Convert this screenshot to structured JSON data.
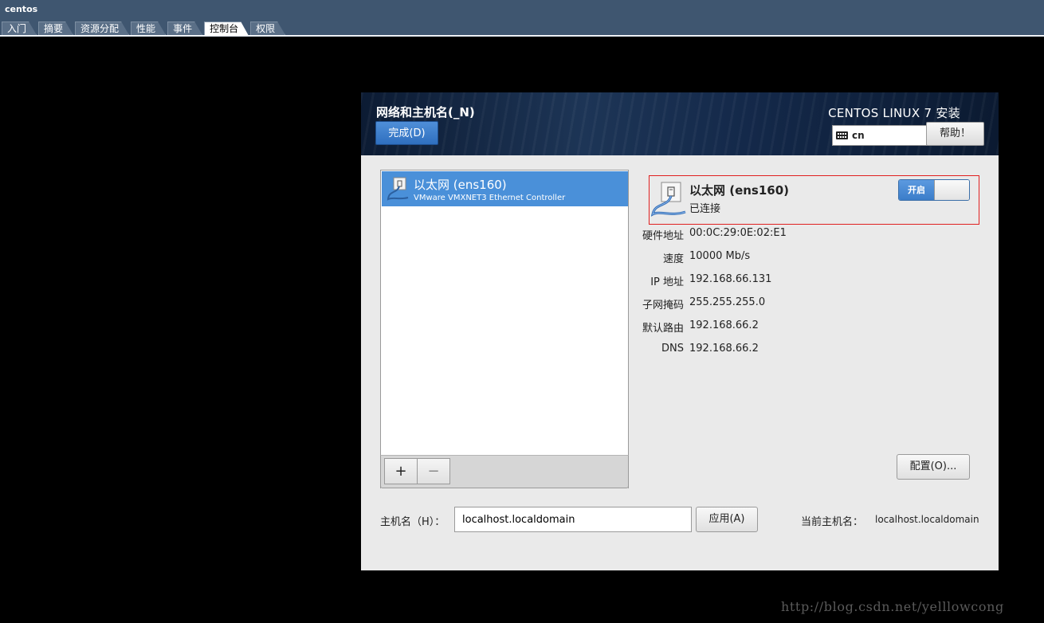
{
  "window": {
    "title": "centos",
    "tabs": [
      {
        "label": "入门",
        "active": false
      },
      {
        "label": "摘要",
        "active": false
      },
      {
        "label": "资源分配",
        "active": false
      },
      {
        "label": "性能",
        "active": false
      },
      {
        "label": "事件",
        "active": false
      },
      {
        "label": "控制台",
        "active": true
      },
      {
        "label": "权限",
        "active": false
      }
    ]
  },
  "header": {
    "spoke_title": "网络和主机名(_N)",
    "done_label": "完成(D)",
    "product_title": "CENTOS LINUX 7 安装",
    "keyboard_layout": "cn",
    "help_label": "帮助！"
  },
  "device_list": {
    "items": [
      {
        "name": "以太网 (ens160)",
        "description": "VMware VMXNET3 Ethernet Controller",
        "selected": true
      }
    ],
    "add_label": "+",
    "remove_label": "−"
  },
  "device_detail": {
    "title": "以太网 (ens160)",
    "status": "已连接",
    "toggle_label": "开启",
    "toggle_on": true,
    "rows": [
      {
        "label": "硬件地址",
        "value": "00:0C:29:0E:02:E1"
      },
      {
        "label": "速度",
        "value": "10000 Mb/s"
      },
      {
        "label": "IP 地址",
        "value": "192.168.66.131"
      },
      {
        "label": "子网掩码",
        "value": "255.255.255.0"
      },
      {
        "label": "默认路由",
        "value": "192.168.66.2"
      },
      {
        "label": "DNS",
        "value": "192.168.66.2"
      }
    ],
    "configure_label": "配置(O)..."
  },
  "hostname": {
    "label": "主机名（H）：",
    "value": "localhost.localdomain",
    "apply_label": "应用(A)",
    "current_label": "当前主机名：",
    "current_value": "localhost.localdomain"
  },
  "watermark": "http://blog.csdn.net/yelllowcong",
  "colors": {
    "selection": "#4a90d9",
    "highlight_border": "#e02020",
    "header_bg": "#14294a",
    "topbar_bg": "#3f5670"
  }
}
